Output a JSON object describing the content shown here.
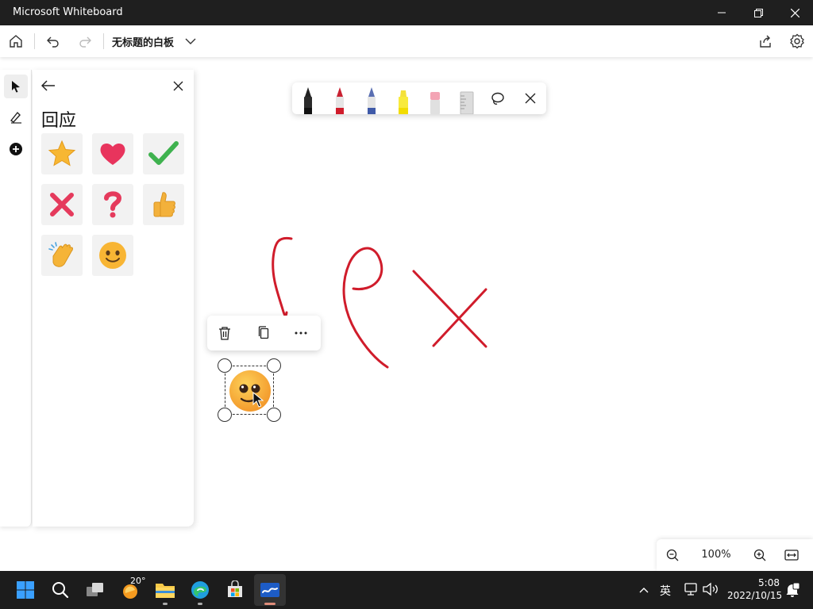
{
  "window": {
    "title": "Microsoft Whiteboard"
  },
  "toolbar": {
    "board_title": "无标题的白板"
  },
  "panel": {
    "title": "回应",
    "emojis": [
      "star",
      "heart",
      "check",
      "cross",
      "question",
      "thumbs-up",
      "clap",
      "smile"
    ]
  },
  "pen_tray": {
    "pens": [
      "black-pen",
      "red-pen",
      "galaxy-pen",
      "yellow-highlighter",
      "eraser",
      "ruler"
    ]
  },
  "zoom": {
    "value": "100%"
  },
  "taskbar": {
    "weather": "20°",
    "ime": "英",
    "time": "5:08",
    "date": "2022/10/15"
  },
  "colors": {
    "ink_red": "#d01c2b",
    "accent": "#1a73e8"
  }
}
